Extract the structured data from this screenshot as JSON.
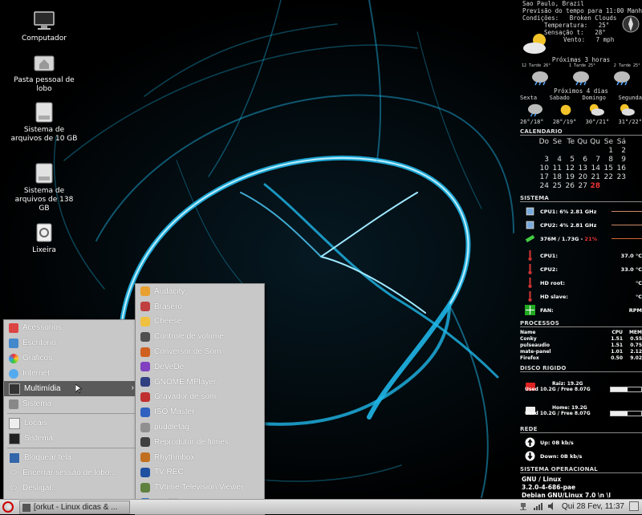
{
  "desktop": {
    "icons": [
      {
        "label": "Computador",
        "icon": "monitor-icon"
      },
      {
        "label": "Pasta pessoal de lobo",
        "icon": "home-folder-icon"
      },
      {
        "label": "Sistema de arquivos de 10 GB",
        "icon": "hard-drive-icon"
      },
      {
        "label": "Sistema de arquivos de 138 GB",
        "icon": "hard-drive-icon"
      },
      {
        "label": "Lixeira",
        "icon": "trash-icon"
      }
    ]
  },
  "weather": {
    "location": "Sao Paulo, Brazil",
    "forecast_time": "Previsão do tempo para 11:00 Manha",
    "conditions": "Condições:   Broken Clouds",
    "temperature": "Temperatura:   25°",
    "feels_like": "Sensação t:   28°",
    "wind": "Vento:   7 mph",
    "next_hours_title": "Próximas 3 horas",
    "next_hours": [
      "12 Tarde 26°",
      "1 Tarde 25°",
      "2 Tarde 25°"
    ],
    "next_days_title": "Próximos 4 dias",
    "days": [
      {
        "name": "Sexta",
        "temps": "26°/18°"
      },
      {
        "name": "Sabado",
        "temps": "28°/19°"
      },
      {
        "name": "Domingo",
        "temps": "30°/21°"
      },
      {
        "name": "Segunda",
        "temps": "31°/22°"
      }
    ]
  },
  "calendar": {
    "title": "CALENDARIO",
    "weekdays": [
      "Do",
      "Se",
      "Te",
      "Qu",
      "Qu",
      "Se",
      "Sá"
    ],
    "days": [
      "",
      "",
      "",
      "",
      "",
      "1",
      "2",
      "3",
      "4",
      "5",
      "6",
      "7",
      "8",
      "9",
      "10",
      "11",
      "12",
      "13",
      "14",
      "15",
      "16",
      "17",
      "18",
      "19",
      "20",
      "21",
      "22",
      "23",
      "24",
      "25",
      "26",
      "27",
      "28",
      "",
      ""
    ],
    "today": "28"
  },
  "system": {
    "title": "SISTEMA",
    "cpu1": "CPU1: 6%  2.81 GHz",
    "cpu2": "CPU2: 4%  2.81 GHz",
    "mem": "376M / 1.73G - ",
    "mem_pct": "21%",
    "temps": [
      {
        "label": "CPU1:",
        "value": "37.0 °C"
      },
      {
        "label": "CPU2:",
        "value": "33.0 °C"
      },
      {
        "label": "HD root:",
        "value": "°C"
      },
      {
        "label": "HD slave:",
        "value": "°C"
      }
    ],
    "fan_label": "FAN:",
    "fan_value": "RPM"
  },
  "processes": {
    "title": "PROCESSOS",
    "headers": [
      "Name",
      "CPU",
      "MEM"
    ],
    "rows": [
      [
        "Conky",
        "1.51",
        "0.55"
      ],
      [
        "pulseaudio",
        "1.51",
        "0.75"
      ],
      [
        "mate-panel",
        "1.01",
        "2.12"
      ],
      [
        "Firefox",
        "0.50",
        "9.02"
      ]
    ]
  },
  "disks": {
    "title": "DISCO RIGIDO",
    "root_label": "Raiz: 19.2G",
    "root_usage": "Used 10.2G / Free 8.07G",
    "root_used_fraction": 0.56,
    "home_label": "Home: 19.2G",
    "home_usage": "Used 10.2G / Free 8.07G",
    "home_used_fraction": 0.56
  },
  "network": {
    "title": "REDE",
    "up": "Up: 0B kb/s",
    "down": "Down: 0B kb/s"
  },
  "os": {
    "title": "SISTEMA OPERACIONAL",
    "line1": "GNU / Linux",
    "line2": "3.2.0-4-686-pae",
    "line3": "Debian GNU/Linux 7.0 \\n \\l"
  },
  "menu": {
    "items": [
      {
        "label": "Acessórios",
        "icon": "accessories-icon",
        "arrow": true
      },
      {
        "label": "Escritório",
        "icon": "office-icon",
        "arrow": true
      },
      {
        "label": "Gráficos",
        "icon": "graphics-icon",
        "arrow": true
      },
      {
        "label": "Internet",
        "icon": "internet-icon",
        "arrow": true
      },
      {
        "label": "Multimídia",
        "icon": "multimedia-icon",
        "arrow": true
      },
      {
        "label": "Sistema",
        "icon": "system-icon",
        "arrow": true
      }
    ],
    "places": [
      {
        "label": "Locais",
        "icon": "places-icon"
      },
      {
        "label": "Sistema",
        "icon": "system-menu-icon"
      }
    ],
    "actions": [
      {
        "label": "Bloquear tela",
        "icon": "lock-screen-icon"
      },
      {
        "label": "Encerrar sessão de lobo...",
        "icon": "logout-icon"
      },
      {
        "label": "Desligar...",
        "icon": "shutdown-icon"
      }
    ]
  },
  "submenu": {
    "items": [
      {
        "label": "Audacity",
        "icon": "audacity-icon",
        "color": "#e8a030"
      },
      {
        "label": "Brasero",
        "icon": "brasero-icon",
        "color": "#c04040"
      },
      {
        "label": "Cheese",
        "icon": "cheese-icon",
        "color": "#f0c040"
      },
      {
        "label": "Controle de volume",
        "icon": "volume-icon",
        "color": "#505050"
      },
      {
        "label": "Conversor de Som",
        "icon": "sound-converter-icon",
        "color": "#d06020"
      },
      {
        "label": "DeVeDe",
        "icon": "devede-icon",
        "color": "#8040c0"
      },
      {
        "label": "GNOME MPlayer",
        "icon": "mplayer-icon",
        "color": "#304080"
      },
      {
        "label": "Gravador de som",
        "icon": "sound-recorder-icon",
        "color": "#c03030"
      },
      {
        "label": "ISO Master",
        "icon": "iso-master-icon",
        "color": "#3060c0"
      },
      {
        "label": "puddletag",
        "icon": "puddletag-icon",
        "color": "#909090"
      },
      {
        "label": "Reprodutor de filmes",
        "icon": "movie-player-icon",
        "color": "#404040"
      },
      {
        "label": "Rhythmbox",
        "icon": "rhythmbox-icon",
        "color": "#c07020"
      },
      {
        "label": "TV REC",
        "icon": "tv-rec-icon",
        "color": "#2050a0"
      },
      {
        "label": "TVtime Television Viewer",
        "icon": "tvtime-icon",
        "color": "#608040"
      },
      {
        "label": "WinFF",
        "icon": "winff-icon",
        "color": "#3070c0"
      }
    ]
  },
  "taskbar": {
    "window_label": "[orkut - Linux dicas & ...",
    "clock": "Qui 28 Fev, 11:37"
  }
}
